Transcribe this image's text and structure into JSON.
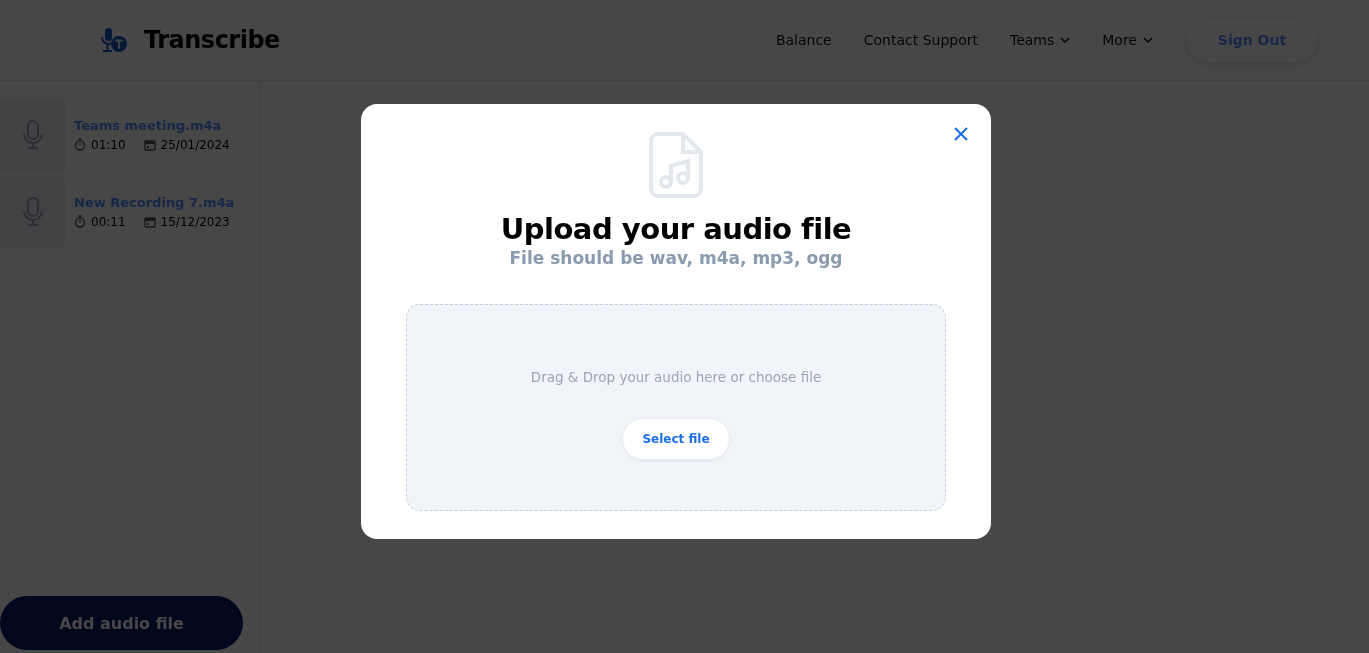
{
  "header": {
    "brand": "Transcribe",
    "nav": [
      {
        "label": "Balance",
        "kind": "link"
      },
      {
        "label": "Contact Support",
        "kind": "link"
      },
      {
        "label": "Teams",
        "kind": "menu"
      },
      {
        "label": "More",
        "kind": "menu"
      }
    ],
    "sign_out": "Sign Out"
  },
  "recordings": [
    {
      "name": "Teams meeting.m4a",
      "duration": "01:10",
      "date": "25/01/2024"
    },
    {
      "name": "New Recording 7.m4a",
      "duration": "00:11",
      "date": "15/12/2023"
    }
  ],
  "add_button": "Add audio file",
  "dialog": {
    "title": "Upload your audio file",
    "subtitle": "File should be wav, m4a, mp3, ogg",
    "drop_hint": "Drag & Drop your audio here or choose file",
    "select_button": "Select file"
  }
}
